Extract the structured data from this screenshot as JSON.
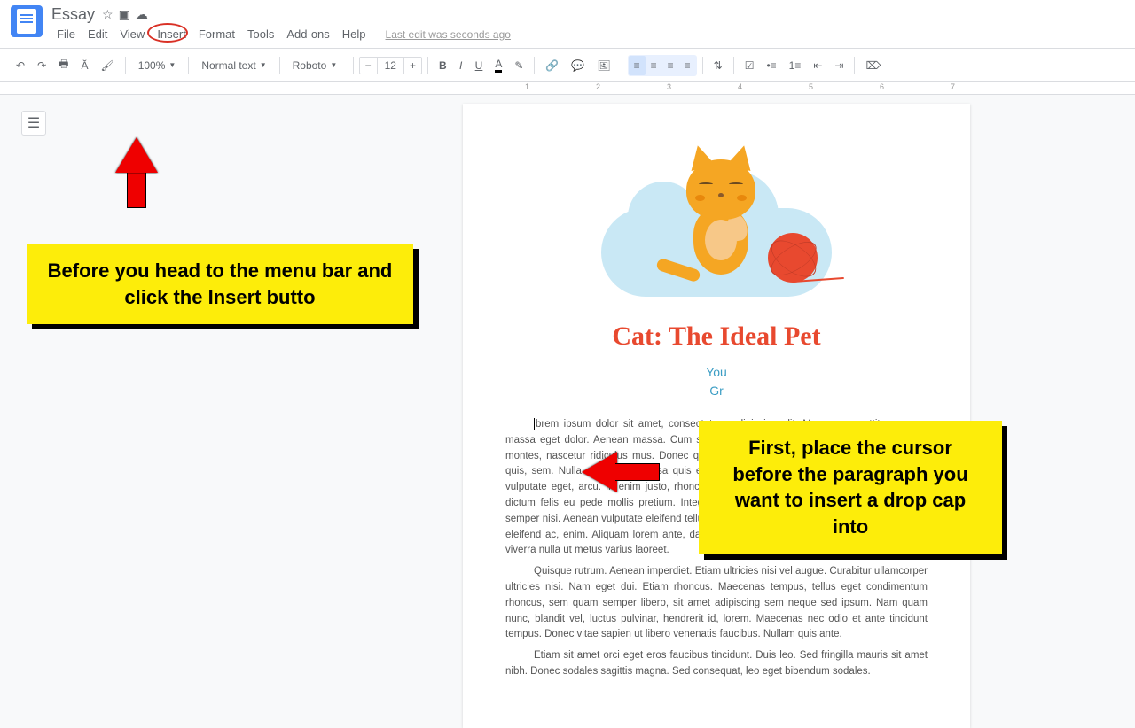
{
  "doc": {
    "title": "Essay"
  },
  "menu": {
    "file": "File",
    "edit": "Edit",
    "view": "View",
    "insert": "Insert",
    "format": "Format",
    "tools": "Tools",
    "addons": "Add-ons",
    "help": "Help",
    "lastEdit": "Last edit was seconds ago"
  },
  "toolbar": {
    "zoom": "100%",
    "style": "Normal text",
    "font": "Roboto",
    "fontSize": "12"
  },
  "ruler": [
    "1",
    "2",
    "3",
    "4",
    "5",
    "6",
    "7"
  ],
  "content": {
    "h1": "Cat: The Ideal Pet",
    "sub1": "You",
    "sub2": "Gr",
    "p1": "brem ipsum dolor sit amet, consectetuer adipiscing elit. Maecenas porttitor congue massa eget dolor. Aenean massa. Cum sociis natoque penatibus et magnis dis parturient montes, nascetur ridiculus mus. Donec quam felis, ultricies nec, pellentesque eu, pretium quis, sem. Nulla consequat massa quis enim. Donec pede justo, fringilla vel, aliquet nec, vulputate eget, arcu. In enim justo, rhoncus ut, imperdiet a, venenatis vitae, justo. Nullam dictum felis eu pede mollis pretium. Integer tincidunt. Cras dapibus. Vivamus elementum semper nisi. Aenean vulputate eleifend tellus. Aenean leo ligula, porttitor eu, consequat vitae, eleifend ac, enim. Aliquam lorem ante, dapibus in, viverra quis, feugiat a, tellus. Phasellus viverra nulla ut metus varius laoreet.",
    "p2": "Quisque rutrum. Aenean imperdiet. Etiam ultricies nisi vel augue. Curabitur ullamcorper ultricies nisi. Nam eget dui. Etiam rhoncus. Maecenas tempus, tellus eget condimentum rhoncus, sem quam semper libero, sit amet adipiscing sem neque sed ipsum. Nam quam nunc, blandit vel, luctus pulvinar, hendrerit id, lorem. Maecenas nec odio et ante tincidunt tempus. Donec vitae sapien ut libero venenatis faucibus. Nullam quis ante.",
    "p3": "Etiam sit amet orci eget eros faucibus tincidunt. Duis leo. Sed fringilla mauris sit amet nibh. Donec sodales sagittis magna. Sed consequat, leo eget bibendum sodales."
  },
  "annotations": {
    "c1": "Before you head to the menu bar and click the Insert butto",
    "c2": "First, place the cursor before the paragraph you want to insert a drop cap into"
  }
}
